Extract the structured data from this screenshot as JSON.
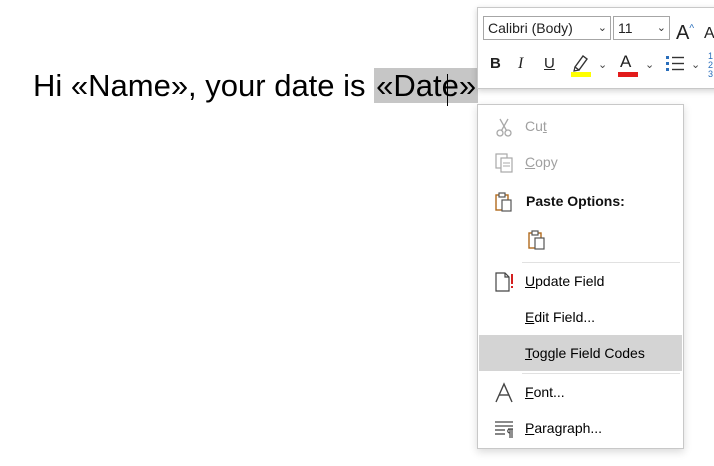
{
  "document": {
    "text_before": "Hi «Name», your date is ",
    "field_date": "«Date»"
  },
  "mini_toolbar": {
    "font_name": "Calibri (Body)",
    "font_size": "11",
    "bold": "B",
    "italic": "I",
    "underline": "U",
    "grow_font": "A",
    "shrink_font": "A",
    "font_color_letter": "A",
    "highlight_color": "#ffff00",
    "font_color": "#e21b1b"
  },
  "context_menu": {
    "items": [
      {
        "label_pre": "Cu",
        "label_acc": "t",
        "label_post": "",
        "enabled": false,
        "icon": "scissors-icon"
      },
      {
        "label_pre": "",
        "label_acc": "C",
        "label_post": "opy",
        "enabled": false,
        "icon": "copy-icon"
      },
      {
        "label": "Paste Options:",
        "header": true,
        "icon": "paste-icon"
      },
      {
        "label_pre": "",
        "label_acc": "U",
        "label_post": "pdate Field",
        "enabled": true,
        "icon": "update-field-icon"
      },
      {
        "label_pre": "",
        "label_acc": "E",
        "label_post": "dit Field...",
        "enabled": true
      },
      {
        "label_pre": "",
        "label_acc": "T",
        "label_post": "oggle Field Codes",
        "enabled": true,
        "highlighted": true
      },
      {
        "label_pre": "",
        "label_acc": "F",
        "label_post": "ont...",
        "enabled": true,
        "icon": "font-icon"
      },
      {
        "label_pre": "",
        "label_acc": "P",
        "label_post": "aragraph...",
        "enabled": true,
        "icon": "paragraph-icon"
      }
    ]
  }
}
